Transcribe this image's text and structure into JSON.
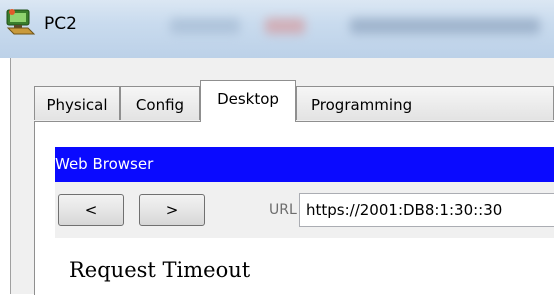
{
  "window": {
    "title": "PC2",
    "icon": "pc-icon"
  },
  "tabs": [
    {
      "label": "Physical",
      "active": false
    },
    {
      "label": "Config",
      "active": false
    },
    {
      "label": "Desktop",
      "active": true
    },
    {
      "label": "Programming",
      "active": false
    }
  ],
  "browser": {
    "title": "Web Browser",
    "title_bar_color": "#0a0aff",
    "back_label": "<",
    "forward_label": ">",
    "url_label": "URL",
    "url_value": "https://2001:DB8:1:30::30",
    "page_message": "Request Timeout"
  }
}
